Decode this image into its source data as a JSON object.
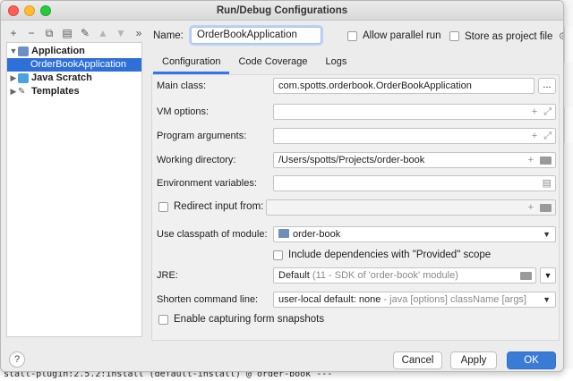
{
  "window": {
    "title": "Run/Debug Configurations"
  },
  "background": {
    "console_text": "stall-plugin:2.5.2:install (default-install) @ order-book ---"
  },
  "toolbar": {
    "icons": [
      "plus-icon",
      "minus-icon",
      "copy-icon",
      "save-icon",
      "wrench-icon",
      "arrow-up-icon",
      "arrow-down-icon",
      "expand-icon"
    ],
    "glyphs": [
      "+",
      "−",
      "⧉",
      "▤",
      "✎",
      "▲",
      "▼",
      "»"
    ]
  },
  "tree": {
    "application": "Application",
    "selected_item": "OrderBookApplication",
    "java_scratch": "Java Scratch",
    "templates": "Templates"
  },
  "header": {
    "name_label": "Name:",
    "name_value": "OrderBookApplication",
    "allow_parallel_run": "Allow parallel run",
    "store_as_project_file": "Store as project file"
  },
  "tabs": [
    "Configuration",
    "Code Coverage",
    "Logs"
  ],
  "form": {
    "main_class_label": "Main class:",
    "main_class_value": "com.spotts.orderbook.OrderBookApplication",
    "vm_options_label": "VM options:",
    "program_arguments_label": "Program arguments:",
    "working_directory_label": "Working directory:",
    "working_directory_value": "/Users/spotts/Projects/order-book",
    "environment_variables_label": "Environment variables:",
    "redirect_input_label": "Redirect input from:",
    "classpath_label": "Use classpath of module:",
    "classpath_value": "order-book",
    "include_dependencies_label": "Include dependencies with \"Provided\" scope",
    "jre_label": "JRE:",
    "jre_value": "Default",
    "jre_detail": "(11 - SDK of 'order-book' module)",
    "shorten_label": "Shorten command line:",
    "shorten_value": "user-local default: none",
    "shorten_detail": "- java [options] className [args]",
    "snapshots_label": "Enable capturing form snapshots",
    "dots_label": "..."
  },
  "footer": {
    "help": "?",
    "cancel": "Cancel",
    "apply": "Apply",
    "ok": "OK"
  },
  "colors": {
    "selection": "#2e6fd8",
    "ok_button": "#3a7bd5",
    "tab_underline": "#3574f0"
  }
}
